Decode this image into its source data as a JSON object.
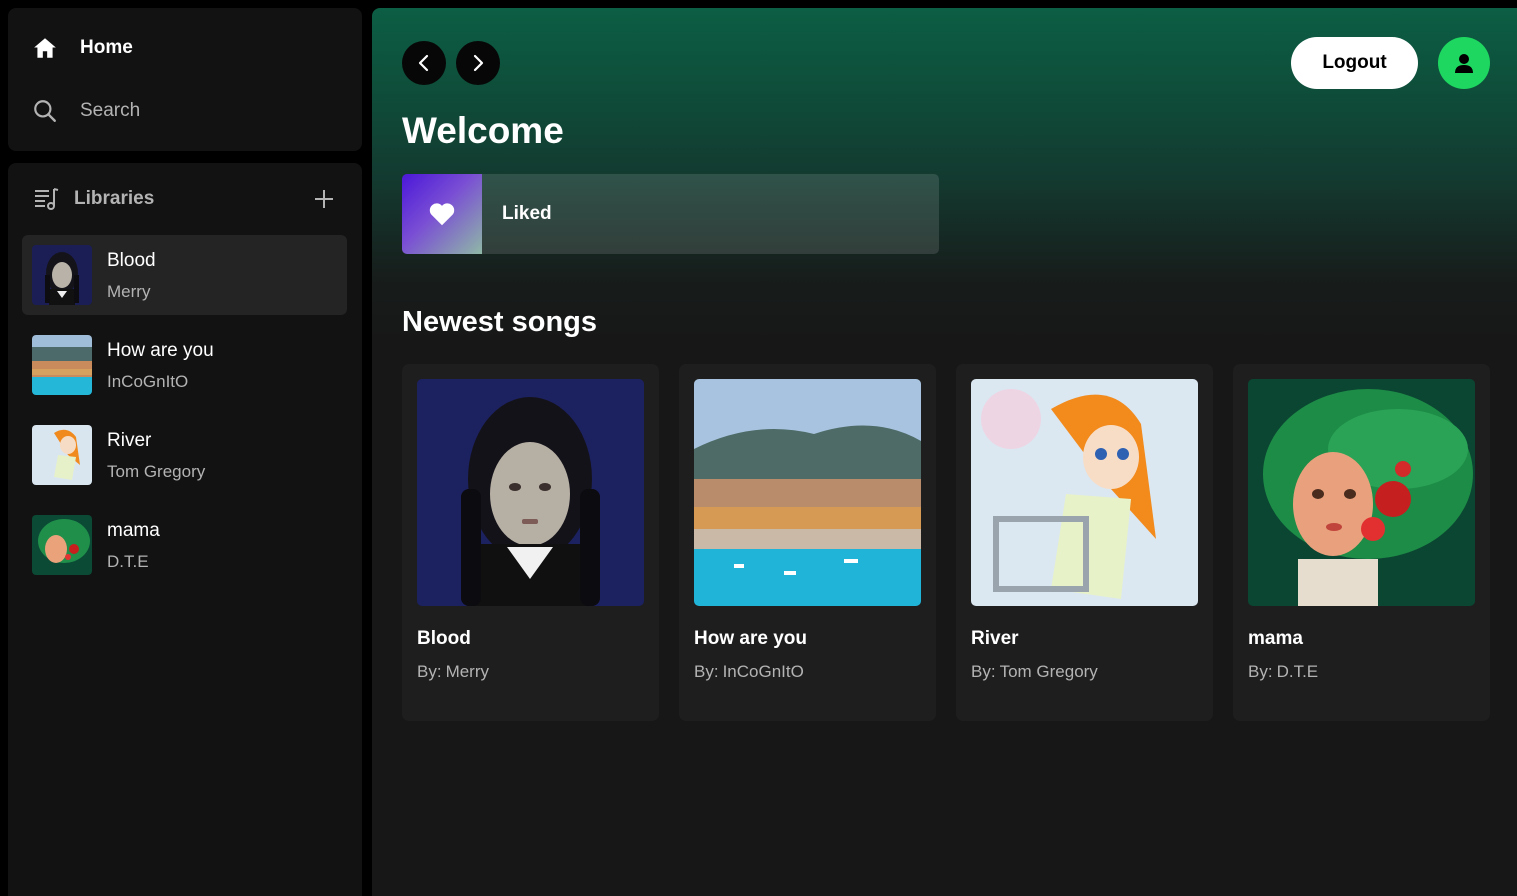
{
  "nav": {
    "home_label": "Home",
    "search_label": "Search"
  },
  "library": {
    "title": "Libraries",
    "items": [
      {
        "title": "Blood",
        "artist": "Merry",
        "art": "girl-braids-art"
      },
      {
        "title": "How are you",
        "artist": "InCoGnItO",
        "art": "coastal-city-art"
      },
      {
        "title": "River",
        "artist": "Tom Gregory",
        "art": "anime-girl-art"
      },
      {
        "title": "mama",
        "artist": "D.T.E",
        "art": "green-hair-art"
      }
    ]
  },
  "header": {
    "logout_label": "Logout",
    "welcome": "Welcome",
    "liked_label": "Liked"
  },
  "newest": {
    "title": "Newest songs",
    "by_prefix": "By:",
    "songs": [
      {
        "title": "Blood",
        "artist": "Merry",
        "art": "girl-braids-art"
      },
      {
        "title": "How are you",
        "artist": "InCoGnItO",
        "art": "coastal-city-art"
      },
      {
        "title": "River",
        "artist": "Tom Gregory",
        "art": "anime-girl-art"
      },
      {
        "title": "mama",
        "artist": "D.T.E",
        "art": "green-hair-art"
      }
    ]
  },
  "colors": {
    "accent": "#1ed760",
    "panel": "#121212",
    "header_gradient": "#0c5e44"
  }
}
